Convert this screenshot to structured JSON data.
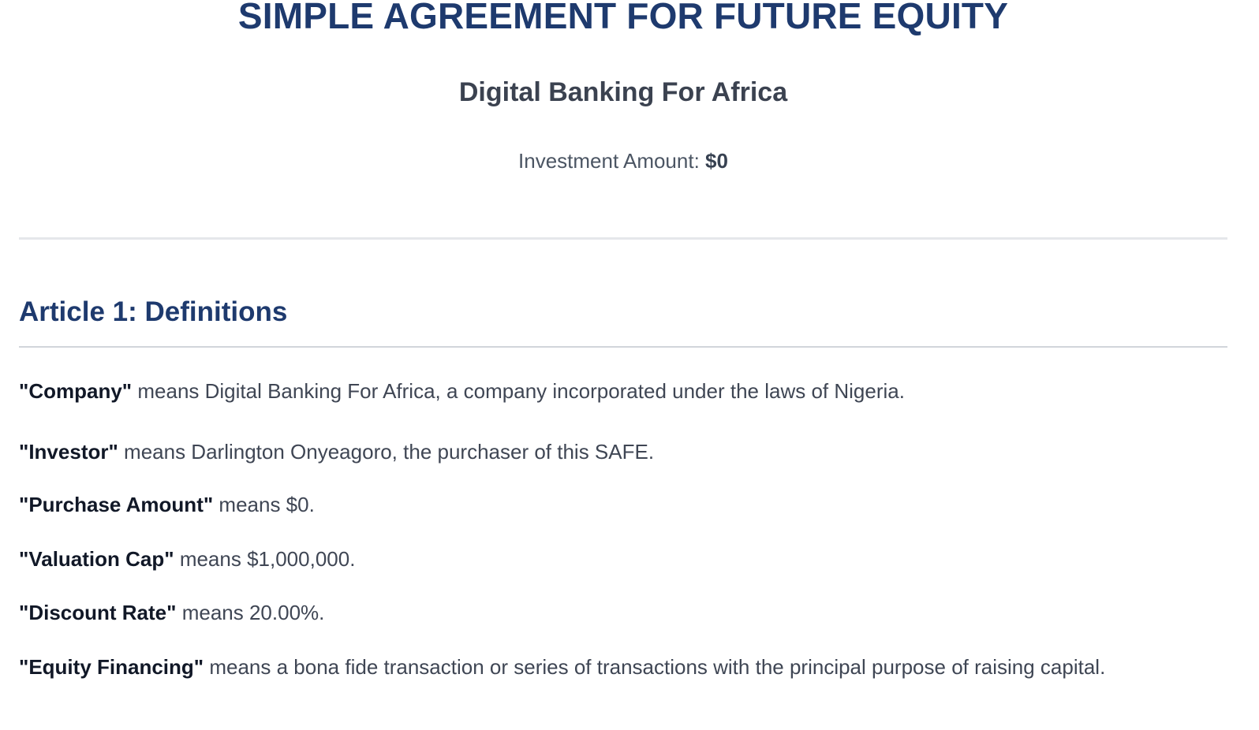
{
  "header": {
    "title": "SIMPLE AGREEMENT FOR FUTURE EQUITY",
    "company_name": "Digital Banking For Africa",
    "investment_label": "Investment Amount:",
    "investment_amount": "$0"
  },
  "article": {
    "heading": "Article 1: Definitions"
  },
  "definitions": [
    {
      "term": "\"Company\"",
      "text": "means Digital Banking For Africa, a company incorporated under the laws of Nigeria."
    },
    {
      "term": "\"Investor\"",
      "text": "means Darlington Onyeagoro, the purchaser of this SAFE."
    },
    {
      "term": "\"Purchase Amount\"",
      "text": "means $0."
    },
    {
      "term": "\"Valuation Cap\"",
      "text": "means $1,000,000."
    },
    {
      "term": "\"Discount Rate\"",
      "text": "means 20.00%."
    },
    {
      "term": "\"Equity Financing\"",
      "text": "means a bona fide transaction or series of transactions with the principal purpose of raising capital."
    }
  ]
}
